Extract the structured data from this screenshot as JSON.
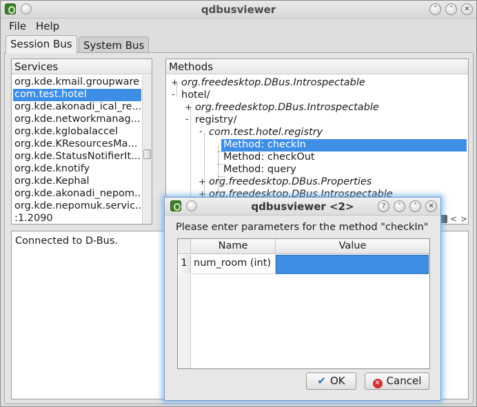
{
  "window": {
    "title": "qdbusviewer"
  },
  "menu": {
    "file": "File",
    "help": "Help"
  },
  "tabs": [
    {
      "label": "Session Bus",
      "active": true
    },
    {
      "label": "System Bus",
      "active": false
    }
  ],
  "services": {
    "header": "Services",
    "items": [
      "org.kde.kmail.groupware",
      "com.test.hotel",
      "org.kde.akonadi_ical_re...",
      "org.kde.networkmanag...",
      "org.kde.kglobalaccel",
      "org.kde.KResourcesMa...",
      "org.kde.StatusNotifierIt...",
      "org.kde.knotify",
      "org.kde.Kephal",
      "org.kde.akonadi_nepom...",
      "org.kde.nepomuk.servic...",
      ":1.2090"
    ],
    "selected_index": 1
  },
  "methods": {
    "header": "Methods",
    "rows": [
      {
        "text": "org.freedesktop.DBus.Introspectable",
        "expander": "+"
      },
      {
        "text": "hotel/",
        "expander": "-"
      },
      {
        "text": "org.freedesktop.DBus.Introspectable",
        "expander": "+"
      },
      {
        "text": "registry/",
        "expander": "-"
      },
      {
        "text": "com.test.hotel.registry",
        "expander": "-"
      },
      {
        "text": "Method: checkIn",
        "expander": ""
      },
      {
        "text": "Method: checkOut",
        "expander": ""
      },
      {
        "text": "Method: query",
        "expander": ""
      },
      {
        "text": "org.freedesktop.DBus.Properties",
        "expander": "+"
      },
      {
        "text": "org.freedesktop.DBus.Introspectable",
        "expander": "+"
      }
    ]
  },
  "log": {
    "text": "Connected to D-Bus."
  },
  "dialog": {
    "title": "qdbusviewer <2>",
    "prompt": "Please enter parameters for the method \"checkIn\"",
    "columns": [
      "Name",
      "Value"
    ],
    "rows": [
      {
        "index": "1",
        "name": "num_room (int)",
        "value": ""
      }
    ],
    "ok_label": "OK",
    "cancel_label": "Cancel",
    "title_buttons": [
      "?",
      "˅",
      "˄",
      "✕"
    ]
  },
  "wm_buttons": [
    "˅",
    "˄",
    "✕"
  ],
  "colors": {
    "selection": "#3e8ee6",
    "dialog_glow": "#6ea9e6"
  },
  "icons": {
    "app": "qt-app-icon",
    "ok": "check-icon",
    "cancel": "cancel-icon"
  }
}
